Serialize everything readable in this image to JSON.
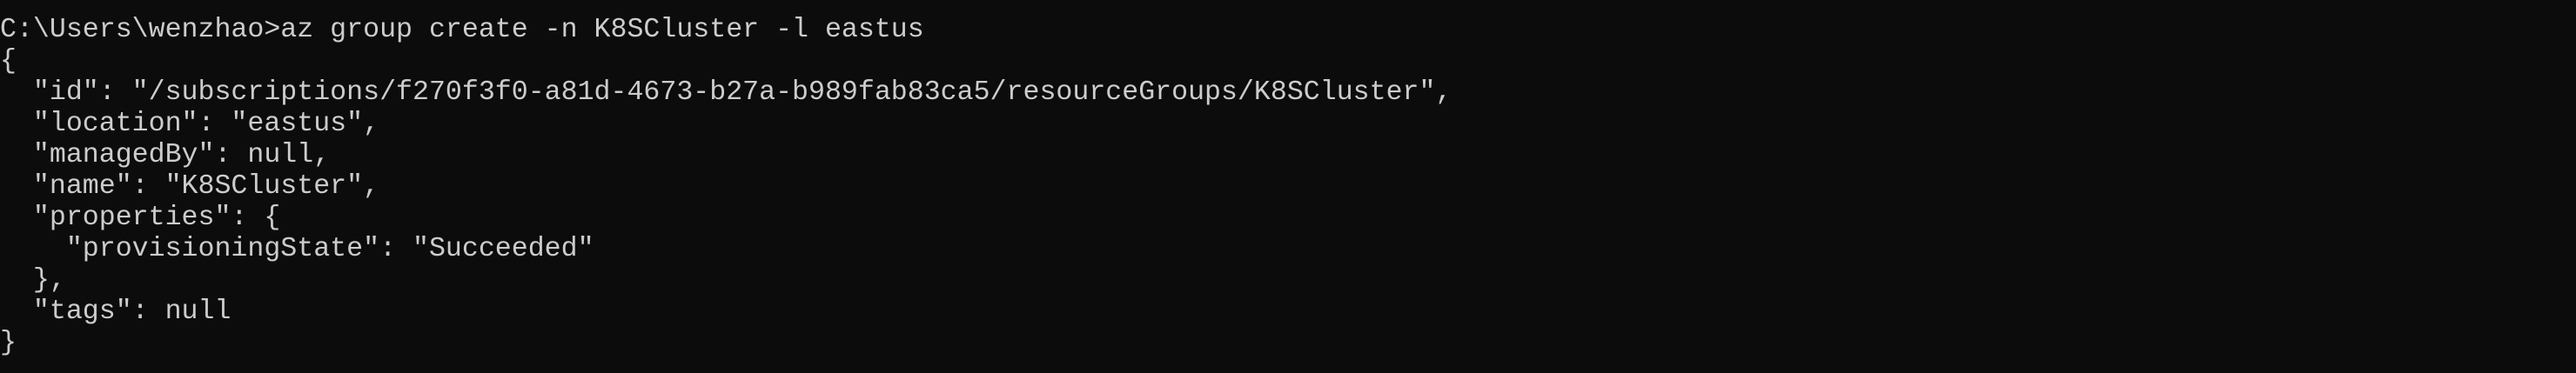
{
  "terminal": {
    "colors": {
      "background": "#0c0c0c",
      "foreground": "#cccccc"
    },
    "lines": [
      "C:\\Users\\wenzhao>az group create -n K8SCluster -l eastus",
      "{",
      "  \"id\": \"/subscriptions/f270f3f0-a81d-4673-b27a-b989fab83ca5/resourceGroups/K8SCluster\",",
      "  \"location\": \"eastus\",",
      "  \"managedBy\": null,",
      "  \"name\": \"K8SCluster\",",
      "  \"properties\": {",
      "    \"provisioningState\": \"Succeeded\"",
      "  },",
      "  \"tags\": null",
      "}"
    ]
  }
}
